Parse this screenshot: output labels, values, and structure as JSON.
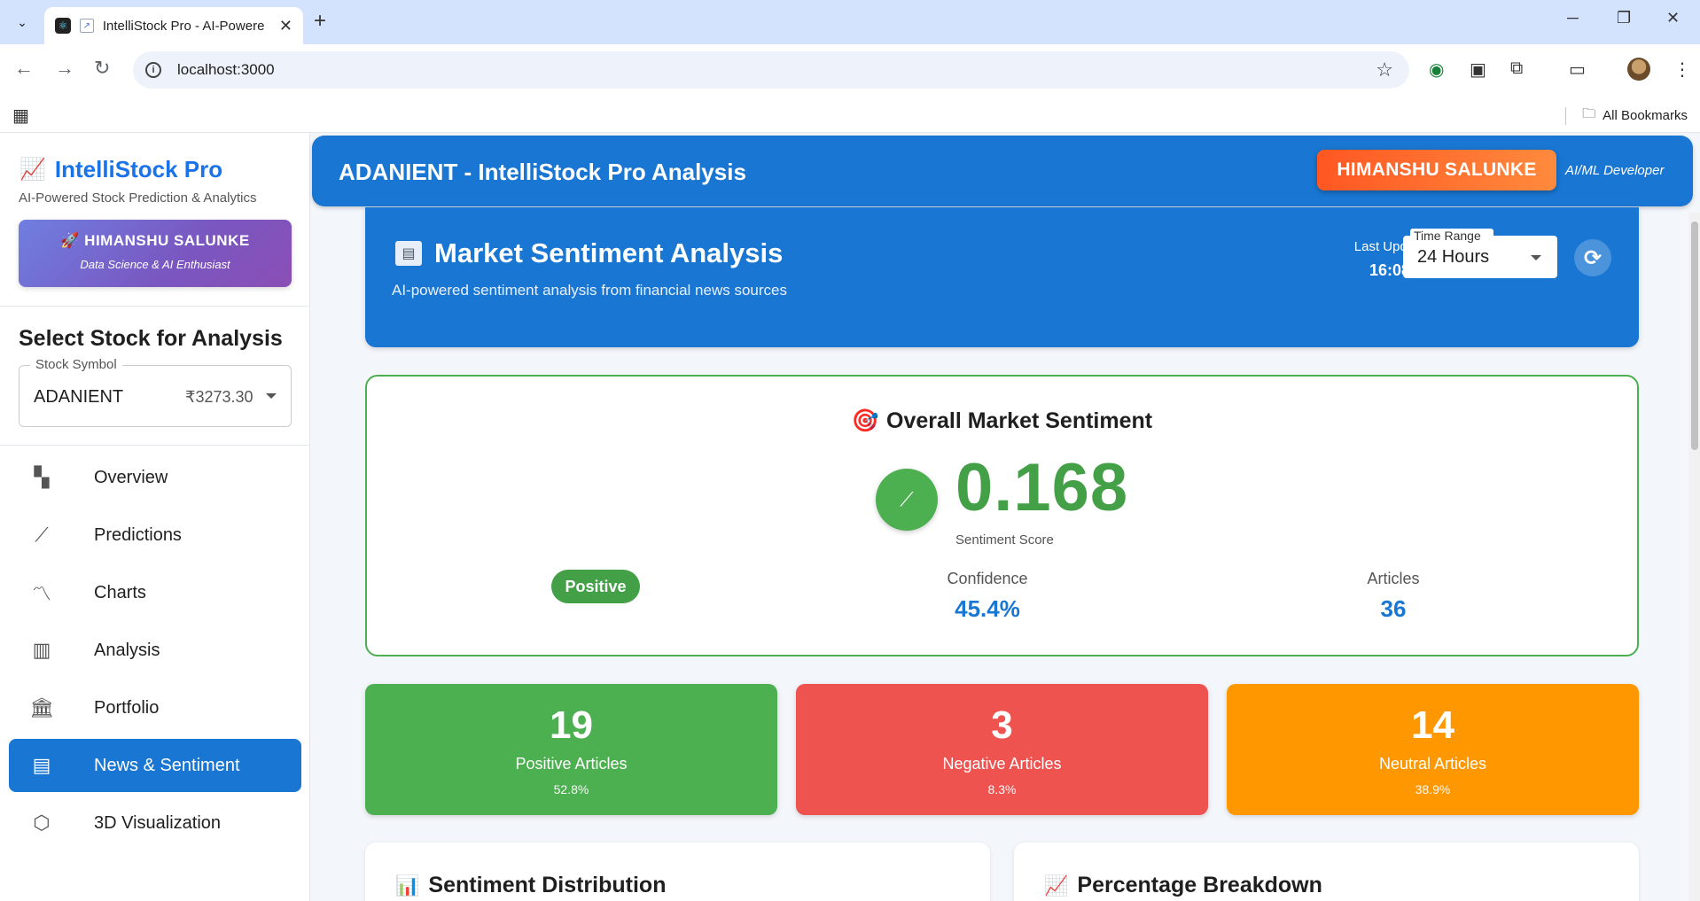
{
  "browser": {
    "tab_title": "IntelliStock Pro - AI-Powere",
    "url": "localhost:3000",
    "bookmarks_label": "All Bookmarks"
  },
  "sidebar": {
    "brand": "IntelliStock Pro",
    "tagline": "AI-Powered Stock Prediction & Analytics",
    "developer_name": "🚀 HIMANSHU SALUNKE",
    "developer_role": "Data Science & AI Enthusiast",
    "select_title": "Select Stock for Analysis",
    "stock_select": {
      "label": "Stock Symbol",
      "symbol": "ADANIENT",
      "price": "₹3273.30"
    },
    "nav": [
      {
        "label": "Overview",
        "icon": "dashboard-icon",
        "active": false
      },
      {
        "label": "Predictions",
        "icon": "trending-up-icon",
        "active": false
      },
      {
        "label": "Charts",
        "icon": "show-chart-icon",
        "active": false
      },
      {
        "label": "Analysis",
        "icon": "analytics-icon",
        "active": false
      },
      {
        "label": "Portfolio",
        "icon": "bank-icon",
        "active": false
      },
      {
        "label": "News & Sentiment",
        "icon": "article-icon",
        "active": true
      },
      {
        "label": "3D Visualization",
        "icon": "cube-icon",
        "active": false
      }
    ]
  },
  "header": {
    "title": "ADANIENT - IntelliStock Pro Analysis",
    "badge": "HIMANSHU SALUNKE",
    "role": "AI/ML Developer"
  },
  "banner": {
    "title": "Market Sentiment Analysis",
    "subtitle": "AI-powered sentiment analysis from financial news sources",
    "last_updated_label": "Last Updated",
    "last_updated_value": "16:08:01",
    "time_range_label": "Time Range",
    "time_range_value": "24 Hours"
  },
  "overall": {
    "title": "Overall Market Sentiment",
    "score": "0.168",
    "score_label": "Sentiment Score",
    "sentiment": "Positive",
    "confidence_label": "Confidence",
    "confidence_value": "45.4%",
    "articles_label": "Articles",
    "articles_value": "36"
  },
  "counts": [
    {
      "number": "19",
      "label": "Positive Articles",
      "pct": "52.8%",
      "color": "#4caf50"
    },
    {
      "number": "3",
      "label": "Negative Articles",
      "pct": "8.3%",
      "color": "#ef5350"
    },
    {
      "number": "14",
      "label": "Neutral Articles",
      "pct": "38.9%",
      "color": "#ff9800"
    }
  ],
  "sections": {
    "distribution": "Sentiment Distribution",
    "breakdown": "Percentage Breakdown"
  },
  "colors": {
    "primary": "#1976d2",
    "positive": "#43a047",
    "badge": "#ff5722"
  }
}
